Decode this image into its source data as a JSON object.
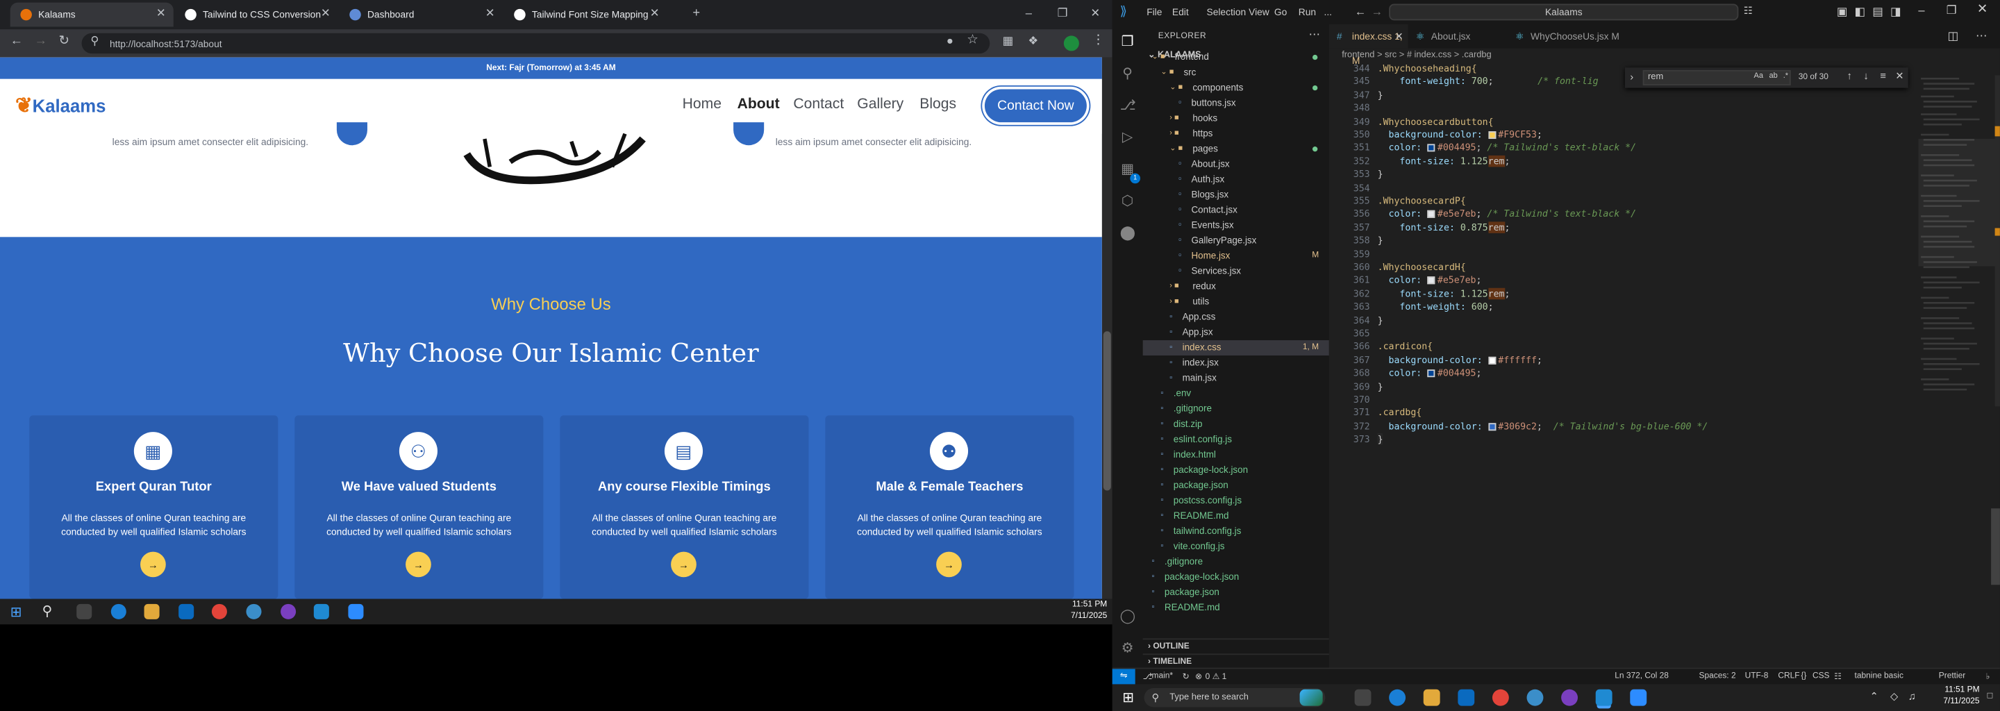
{
  "browser": {
    "tabs": [
      {
        "title": "Kalaams",
        "active": true,
        "icon_color": "#e8710a"
      },
      {
        "title": "Tailwind to CSS Conversion",
        "active": false,
        "icon_color": "#ffffff"
      },
      {
        "title": "Dashboard",
        "active": false,
        "icon_color": "#5f8bd6"
      },
      {
        "title": "Tailwind Font Size Mapping",
        "active": false,
        "icon_color": "#ffffff"
      }
    ],
    "url": "http://localhost:5173/about",
    "icons": [
      "back-icon",
      "forward-icon",
      "reload-icon",
      "site-info-icon",
      "location-icon",
      "star-icon",
      "extensions-icon",
      "profile-icon",
      "menu-icon"
    ]
  },
  "site": {
    "prayer_banner": "Next: Fajr (Tomorrow) at 3:45 AM",
    "logo_text": "Kalaams",
    "nav": [
      "Home",
      "About",
      "Contact",
      "Gallery",
      "Blogs"
    ],
    "active_nav": "About",
    "contact_button": "Contact Now",
    "hero_left_text": "less aim ipsum amet consecter elit adipisicing.",
    "hero_right_text": "less aim ipsum amet consecter elit adipisicing.",
    "section_label": "Why Choose Us",
    "section_heading": "Why Choose Our Islamic Center",
    "cards": [
      {
        "title": "Expert Quran Tutor",
        "icon": "chalkboard-teacher-icon",
        "desc": "All the classes of online Quran teaching are conducted by well qualified Islamic scholars"
      },
      {
        "title": "We Have valued Students",
        "icon": "users-icon",
        "desc": "All the classes of online Quran teaching are conducted by well qualified Islamic scholars"
      },
      {
        "title": "Any course Flexible Timings",
        "icon": "calendar-icon",
        "desc": "All the classes of online Quran teaching are conducted by well qualified Islamic scholars"
      },
      {
        "title": "Male & Female Teachers",
        "icon": "user-friends-icon",
        "desc": "All the classes of online Quran teaching are conducted by well qualified Islamic scholars"
      }
    ],
    "card_arrow": "→",
    "accent": "#3069c2",
    "card_color": "#2a5db0",
    "yellow": "#f9cf53"
  },
  "inner_taskbar": {
    "time": "11:51 PM",
    "date": "7/11/2025"
  },
  "vscode": {
    "menu": [
      "File",
      "Edit",
      "Selection",
      "View",
      "Go",
      "Run",
      "..."
    ],
    "command_center": "Kalaams",
    "explorer_title": "EXPLORER",
    "root": "KALAAMS",
    "tree": [
      {
        "label": "frontend",
        "indent": 1,
        "type": "folder-open",
        "dot": true
      },
      {
        "label": "src",
        "indent": 2,
        "type": "folder-open"
      },
      {
        "label": "components",
        "indent": 3,
        "type": "folder-open",
        "dot": true
      },
      {
        "label": "buttons.jsx",
        "indent": 4,
        "type": "file"
      },
      {
        "label": "hooks",
        "indent": 3,
        "type": "folder"
      },
      {
        "label": "https",
        "indent": 3,
        "type": "folder"
      },
      {
        "label": "pages",
        "indent": 3,
        "type": "folder-open",
        "dot": true
      },
      {
        "label": "About.jsx",
        "indent": 4,
        "type": "file"
      },
      {
        "label": "Auth.jsx",
        "indent": 4,
        "type": "file"
      },
      {
        "label": "Blogs.jsx",
        "indent": 4,
        "type": "file"
      },
      {
        "label": "Contact.jsx",
        "indent": 4,
        "type": "file"
      },
      {
        "label": "Events.jsx",
        "indent": 4,
        "type": "file"
      },
      {
        "label": "GalleryPage.jsx",
        "indent": 4,
        "type": "file"
      },
      {
        "label": "Home.jsx",
        "indent": 4,
        "type": "file",
        "badge": "M"
      },
      {
        "label": "Services.jsx",
        "indent": 4,
        "type": "file"
      },
      {
        "label": "redux",
        "indent": 3,
        "type": "folder"
      },
      {
        "label": "utils",
        "indent": 3,
        "type": "folder"
      },
      {
        "label": "App.css",
        "indent": 3,
        "type": "file"
      },
      {
        "label": "App.jsx",
        "indent": 3,
        "type": "file"
      },
      {
        "label": "index.css",
        "indent": 3,
        "type": "file",
        "badge": "1, M",
        "selected": true
      },
      {
        "label": "index.jsx",
        "indent": 3,
        "type": "file"
      },
      {
        "label": "main.jsx",
        "indent": 3,
        "type": "file"
      },
      {
        "label": ".env",
        "indent": 2,
        "type": "file"
      },
      {
        "label": ".gitignore",
        "indent": 2,
        "type": "file"
      },
      {
        "label": "dist.zip",
        "indent": 2,
        "type": "file"
      },
      {
        "label": "eslint.config.js",
        "indent": 2,
        "type": "file"
      },
      {
        "label": "index.html",
        "indent": 2,
        "type": "file"
      },
      {
        "label": "package-lock.json",
        "indent": 2,
        "type": "file"
      },
      {
        "label": "package.json",
        "indent": 2,
        "type": "file"
      },
      {
        "label": "postcss.config.js",
        "indent": 2,
        "type": "file"
      },
      {
        "label": "README.md",
        "indent": 2,
        "type": "file"
      },
      {
        "label": "tailwind.config.js",
        "indent": 2,
        "type": "file"
      },
      {
        "label": "vite.config.js",
        "indent": 2,
        "type": "file"
      },
      {
        "label": ".gitignore",
        "indent": 1,
        "type": "file"
      },
      {
        "label": "package-lock.json",
        "indent": 1,
        "type": "file"
      },
      {
        "label": "package.json",
        "indent": 1,
        "type": "file"
      },
      {
        "label": "README.md",
        "indent": 1,
        "type": "file"
      }
    ],
    "outline": "OUTLINE",
    "timeline": "TIMELINE",
    "editor_tabs": [
      {
        "label": "index.css 1, M",
        "active": true
      },
      {
        "label": "About.jsx",
        "active": false
      },
      {
        "label": "WhyChooseUs.jsx M",
        "active": false
      }
    ],
    "breadcrumb": "frontend > src > # index.css > .cardbg",
    "find": {
      "query": "rem",
      "result": "30 of 30"
    },
    "code": [
      {
        "n": "344",
        "segs": [
          [
            ".Whychooseheading{",
            "sel-c"
          ]
        ]
      },
      {
        "n": "345",
        "segs": [
          [
            "    font-weight: ",
            "prop"
          ],
          [
            "700",
            "num"
          ],
          [
            ";",
            ""
          ],
          [
            "        /* font-lig",
            "com"
          ]
        ]
      },
      {
        "n": "347",
        "segs": [
          [
            "}",
            ""
          ]
        ]
      },
      {
        "n": "348",
        "segs": [
          [
            "",
            ""
          ]
        ]
      },
      {
        "n": "349",
        "segs": [
          [
            ".Whychoosecardbutton{",
            "sel-c"
          ]
        ]
      },
      {
        "n": "350",
        "segs": [
          [
            "  background-color: ",
            "prop"
          ],
          [
            "SW:#F9CF53",
            ""
          ],
          [
            "#F9CF53",
            "val"
          ],
          [
            ";",
            ""
          ]
        ]
      },
      {
        "n": "351",
        "segs": [
          [
            "  color: ",
            "prop"
          ],
          [
            "SW:#004495",
            ""
          ],
          [
            "#004495",
            "val"
          ],
          [
            "; ",
            ""
          ],
          [
            "/* Tailwind's text-black */",
            "com"
          ]
        ]
      },
      {
        "n": "352",
        "segs": [
          [
            "    font-size: ",
            "prop"
          ],
          [
            "1.125",
            "num"
          ],
          [
            "rem",
            "hl"
          ],
          [
            ";",
            ""
          ]
        ]
      },
      {
        "n": "353",
        "segs": [
          [
            "}",
            ""
          ]
        ]
      },
      {
        "n": "354",
        "segs": [
          [
            "",
            ""
          ]
        ]
      },
      {
        "n": "355",
        "segs": [
          [
            ".WhychoosecardP{",
            "sel-c"
          ]
        ]
      },
      {
        "n": "356",
        "segs": [
          [
            "  color: ",
            "prop"
          ],
          [
            "SW:#e5e7eb",
            ""
          ],
          [
            "#e5e7eb",
            "val"
          ],
          [
            "; ",
            ""
          ],
          [
            "/* Tailwind's text-black */",
            "com"
          ]
        ]
      },
      {
        "n": "357",
        "segs": [
          [
            "    font-size: ",
            "prop"
          ],
          [
            "0.875",
            "num"
          ],
          [
            "rem",
            "hl"
          ],
          [
            ";",
            ""
          ]
        ]
      },
      {
        "n": "358",
        "segs": [
          [
            "}",
            ""
          ]
        ]
      },
      {
        "n": "359",
        "segs": [
          [
            "",
            ""
          ]
        ]
      },
      {
        "n": "360",
        "segs": [
          [
            ".WhychoosecardH{",
            "sel-c"
          ]
        ]
      },
      {
        "n": "361",
        "segs": [
          [
            "  color: ",
            "prop"
          ],
          [
            "SW:#e5e7eb",
            ""
          ],
          [
            "#e5e7eb",
            "val"
          ],
          [
            ";",
            ""
          ]
        ]
      },
      {
        "n": "362",
        "segs": [
          [
            "    font-size: ",
            "prop"
          ],
          [
            "1.125",
            "num"
          ],
          [
            "rem",
            "hl"
          ],
          [
            ";",
            ""
          ]
        ]
      },
      {
        "n": "363",
        "segs": [
          [
            "    font-weight: ",
            "prop"
          ],
          [
            "600",
            "num"
          ],
          [
            ";",
            ""
          ]
        ]
      },
      {
        "n": "364",
        "segs": [
          [
            "}",
            ""
          ]
        ]
      },
      {
        "n": "365",
        "segs": [
          [
            "",
            ""
          ]
        ]
      },
      {
        "n": "366",
        "segs": [
          [
            ".cardicon{",
            "sel-c"
          ]
        ]
      },
      {
        "n": "367",
        "segs": [
          [
            "  background-color: ",
            "prop"
          ],
          [
            "SW:#ffffff",
            ""
          ],
          [
            "#ffffff",
            "val"
          ],
          [
            ";",
            ""
          ]
        ]
      },
      {
        "n": "368",
        "segs": [
          [
            "  color: ",
            "prop"
          ],
          [
            "SW:#004495",
            ""
          ],
          [
            "#004495",
            "val"
          ],
          [
            ";",
            ""
          ]
        ]
      },
      {
        "n": "369",
        "segs": [
          [
            "}",
            ""
          ]
        ]
      },
      {
        "n": "370",
        "segs": [
          [
            "",
            ""
          ]
        ]
      },
      {
        "n": "371",
        "segs": [
          [
            ".cardbg{",
            "sel-c"
          ]
        ]
      },
      {
        "n": "372",
        "segs": [
          [
            "  background-color: ",
            "prop"
          ],
          [
            "SW:#3069c2",
            ""
          ],
          [
            "#3069c2",
            "val"
          ],
          [
            ";  ",
            ""
          ],
          [
            "/* Tailwind's bg-blue-600 */",
            "com"
          ]
        ]
      },
      {
        "n": "373",
        "segs": [
          [
            "}",
            ""
          ]
        ]
      }
    ],
    "status": {
      "branch": "main*",
      "problems": "0 ⚠ 1",
      "position": "Ln 372, Col 28",
      "spaces": "Spaces: 2",
      "encoding": "UTF-8",
      "eol": "CRLF",
      "language": "CSS",
      "tabnine": "tabnine basic",
      "prettier": "Prettier"
    }
  },
  "windows_taskbar": {
    "search_placeholder": "Type here to search",
    "time": "11:51 PM",
    "date": "7/11/2025"
  }
}
